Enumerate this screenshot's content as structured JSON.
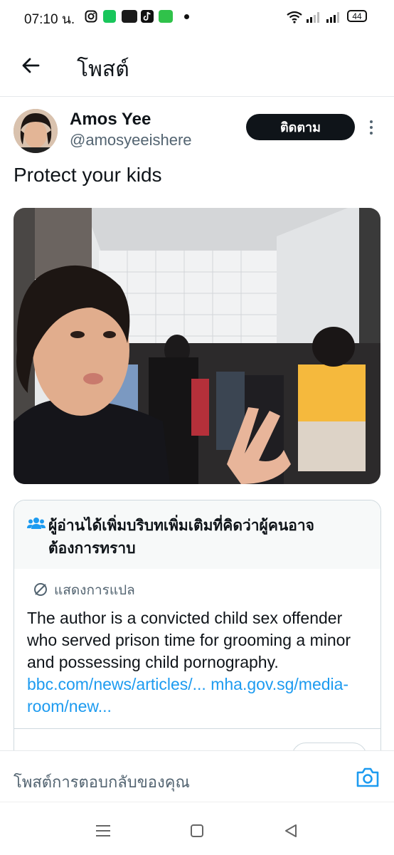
{
  "status_bar": {
    "time": "07:10 น.",
    "battery": "44"
  },
  "header": {
    "title": "โพสต์"
  },
  "post": {
    "author_name": "Amos Yee",
    "author_handle": "@amosyeeishere",
    "follow_label": "ติดตาม",
    "text": "Protect your kids"
  },
  "community_note": {
    "title": "ผู้อ่านได้เพิ่มบริบทเพิ่มเติมที่คิดว่าผู้คนอาจต้องการทราบ",
    "translate_label": "แสดงการแปล",
    "body": "The author is a convicted child sex offender who served prison time for grooming a minor and possessing child pornography.",
    "link1": "bbc.com/news/articles/...",
    "link2": "mha.gov.sg/media-room/new..."
  },
  "reply_bar": {
    "placeholder": "โพสต์การตอบกลับของคุณ"
  },
  "colors": {
    "accent": "#1d9bf0",
    "text": "#0f1419",
    "muted": "#536471"
  }
}
